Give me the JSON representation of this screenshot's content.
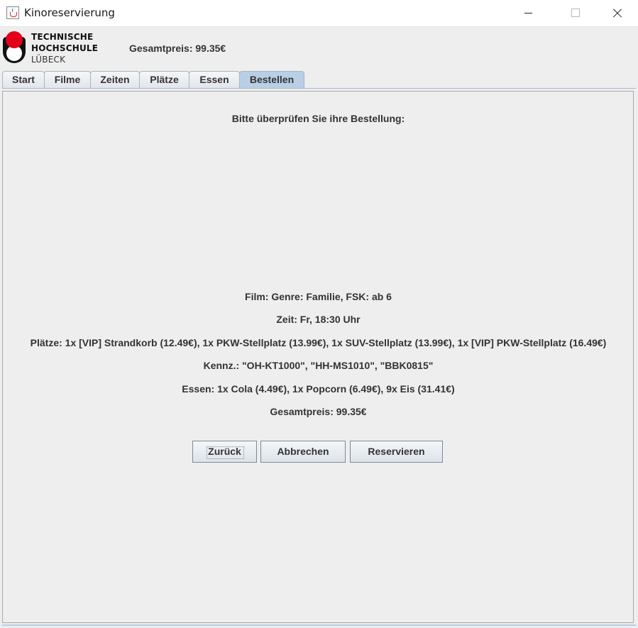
{
  "window": {
    "title": "Kinoreservierung",
    "icon": "java-cup-icon"
  },
  "header": {
    "logo": {
      "line1": "TECHNISCHE",
      "line2": "HOCHSCHULE",
      "line3": "LÜBECK"
    },
    "total_price": "Gesamtpreis: 99.35€"
  },
  "tabs": [
    {
      "label": "Start",
      "active": false
    },
    {
      "label": "Filme",
      "active": false
    },
    {
      "label": "Zeiten",
      "active": false
    },
    {
      "label": "Plätze",
      "active": false
    },
    {
      "label": "Essen",
      "active": false
    },
    {
      "label": "Bestellen",
      "active": true
    }
  ],
  "order": {
    "heading": "Bitte überprüfen Sie ihre Bestellung:",
    "film": "Film: Genre: Familie, FSK: ab 6",
    "time": "Zeit: Fr, 18:30 Uhr",
    "seats": "Plätze: 1x [VIP] Strandkorb (12.49€), 1x PKW-Stellplatz (13.99€), 1x SUV-Stellplatz (13.99€), 1x [VIP] PKW-Stellplatz (16.49€)",
    "plates": "Kennz.: \"OH-KT1000\", \"HH-MS1010\", \"BBK0815\"",
    "food": "Essen: 1x Cola (4.49€), 1x Popcorn (6.49€), 9x Eis (31.41€)",
    "total": "Gesamtpreis: 99.35€"
  },
  "buttons": {
    "back": "Zurück",
    "cancel": "Abbrechen",
    "reserve": "Reservieren"
  },
  "colors": {
    "active_tab": "#b8cfe5",
    "logo_red": "#e2001a",
    "background": "#eeeeee"
  }
}
